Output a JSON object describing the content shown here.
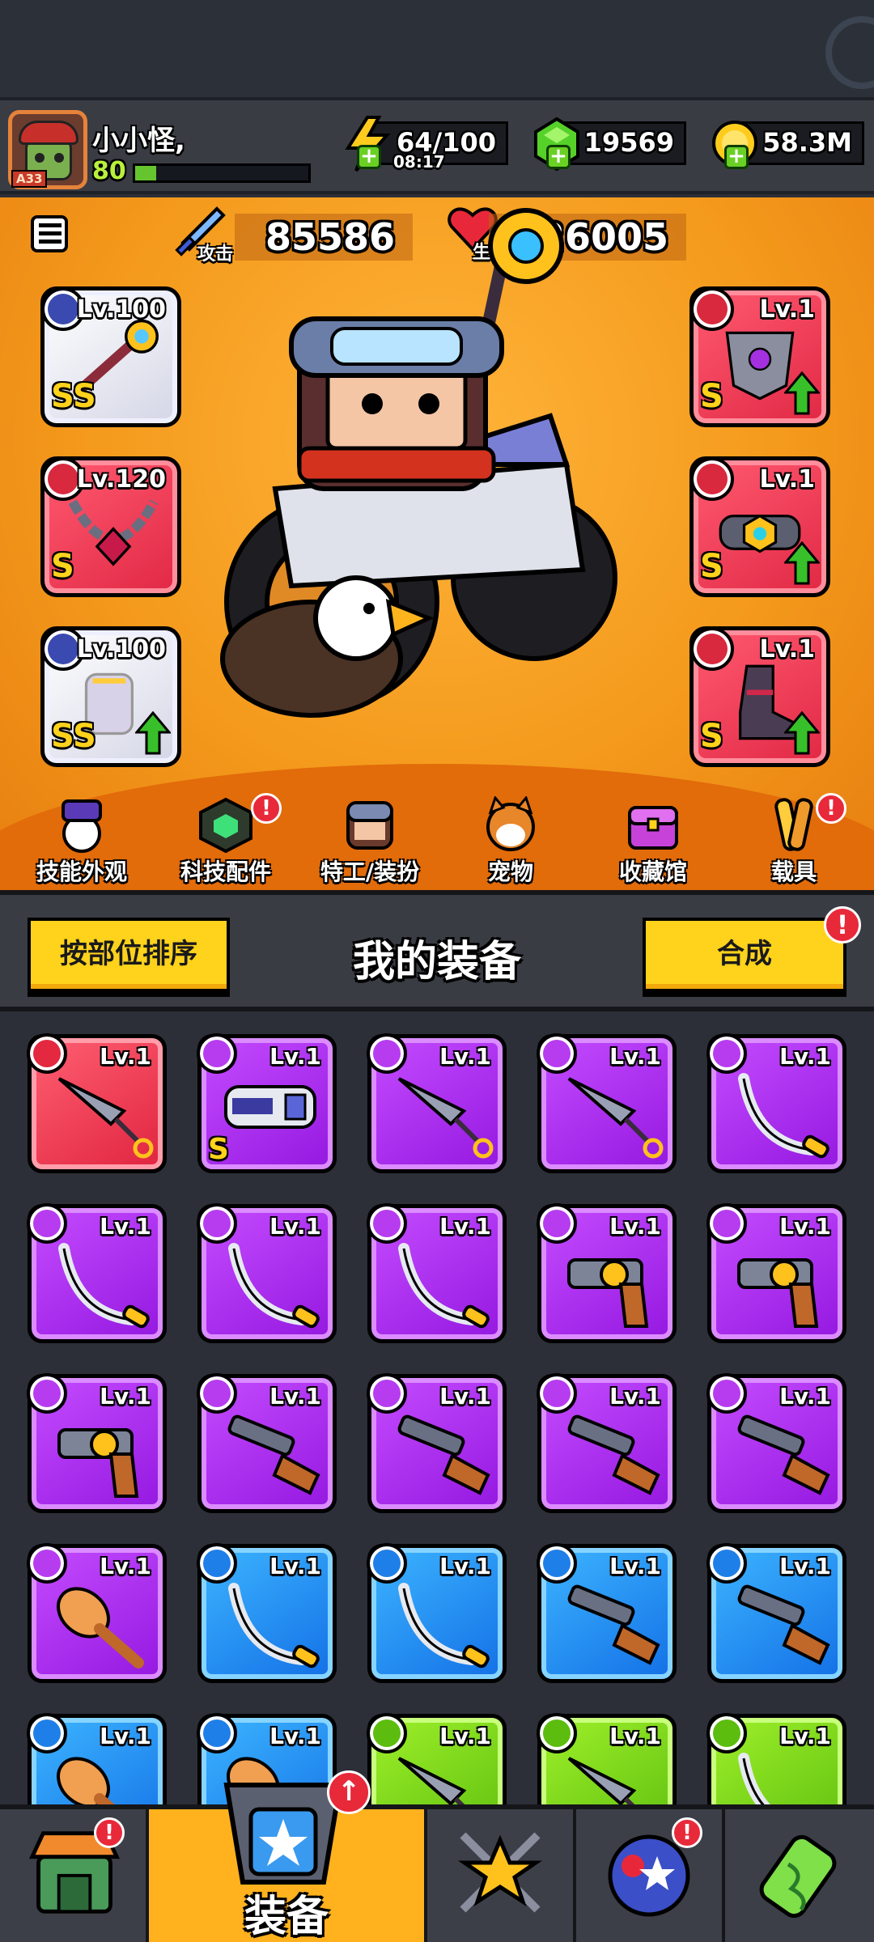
{
  "player": {
    "name": "小小怪,",
    "level": "80",
    "rank": "A33",
    "exp_fraction": 0.12
  },
  "resources": {
    "energy": "64/100",
    "energy_timer": "08:17",
    "gems": "19569",
    "coins": "58.3M"
  },
  "stats": {
    "attack_label": "攻击",
    "attack_value": "85586",
    "hp_label": "生命",
    "hp_value": "226005"
  },
  "equipped": {
    "left": [
      {
        "slot": "weapon",
        "level": "Lv.100",
        "grade": "SS",
        "rarity": "white",
        "upgrade": false
      },
      {
        "slot": "necklace",
        "level": "Lv.120",
        "grade": "S",
        "rarity": "red",
        "upgrade": false
      },
      {
        "slot": "gloves",
        "level": "Lv.100",
        "grade": "SS",
        "rarity": "white",
        "upgrade": true
      }
    ],
    "right": [
      {
        "slot": "armor",
        "level": "Lv.1",
        "grade": "S",
        "rarity": "red",
        "upgrade": true
      },
      {
        "slot": "belt",
        "level": "Lv.1",
        "grade": "S",
        "rarity": "red",
        "upgrade": true
      },
      {
        "slot": "boots",
        "level": "Lv.1",
        "grade": "S",
        "rarity": "red",
        "upgrade": true
      }
    ]
  },
  "hero_nav": [
    {
      "label": "技能外观",
      "icon": "hat-ball-icon",
      "alert": false
    },
    {
      "label": "科技配件",
      "icon": "tech-chip-icon",
      "alert": true
    },
    {
      "label": "特工/装扮",
      "icon": "agent-icon",
      "alert": false
    },
    {
      "label": "宠物",
      "icon": "dog-pet-icon",
      "alert": false
    },
    {
      "label": "收藏馆",
      "icon": "chest-icon",
      "alert": false
    },
    {
      "label": "载具",
      "icon": "skateboard-icon",
      "alert": true
    }
  ],
  "inventory": {
    "sort_label": "按部位排序",
    "title": "我的装备",
    "craft_label": "合成",
    "craft_alert": "!",
    "items": [
      {
        "level": "Lv.1",
        "rarity": "red",
        "type": "kunai",
        "grade": ""
      },
      {
        "level": "Lv.1",
        "rarity": "purple",
        "type": "blaster",
        "grade": "S"
      },
      {
        "level": "Lv.1",
        "rarity": "purple",
        "type": "kunai",
        "grade": ""
      },
      {
        "level": "Lv.1",
        "rarity": "purple",
        "type": "kunai",
        "grade": ""
      },
      {
        "level": "Lv.1",
        "rarity": "purple",
        "type": "katana",
        "grade": ""
      },
      {
        "level": "Lv.1",
        "rarity": "purple",
        "type": "katana",
        "grade": ""
      },
      {
        "level": "Lv.1",
        "rarity": "purple",
        "type": "katana",
        "grade": ""
      },
      {
        "level": "Lv.1",
        "rarity": "purple",
        "type": "katana",
        "grade": ""
      },
      {
        "level": "Lv.1",
        "rarity": "purple",
        "type": "revolver",
        "grade": ""
      },
      {
        "level": "Lv.1",
        "rarity": "purple",
        "type": "revolver",
        "grade": ""
      },
      {
        "level": "Lv.1",
        "rarity": "purple",
        "type": "revolver",
        "grade": ""
      },
      {
        "level": "Lv.1",
        "rarity": "purple",
        "type": "shotgun",
        "grade": ""
      },
      {
        "level": "Lv.1",
        "rarity": "purple",
        "type": "shotgun",
        "grade": ""
      },
      {
        "level": "Lv.1",
        "rarity": "purple",
        "type": "shotgun",
        "grade": ""
      },
      {
        "level": "Lv.1",
        "rarity": "purple",
        "type": "shotgun",
        "grade": ""
      },
      {
        "level": "Lv.1",
        "rarity": "purple",
        "type": "club",
        "grade": ""
      },
      {
        "level": "Lv.1",
        "rarity": "blue",
        "type": "katana",
        "grade": ""
      },
      {
        "level": "Lv.1",
        "rarity": "blue",
        "type": "katana",
        "grade": ""
      },
      {
        "level": "Lv.1",
        "rarity": "blue",
        "type": "shotgun",
        "grade": ""
      },
      {
        "level": "Lv.1",
        "rarity": "blue",
        "type": "shotgun",
        "grade": ""
      },
      {
        "level": "Lv.1",
        "rarity": "blue",
        "type": "club",
        "grade": ""
      },
      {
        "level": "Lv.1",
        "rarity": "blue",
        "type": "club",
        "grade": ""
      },
      {
        "level": "Lv.1",
        "rarity": "green",
        "type": "kunai",
        "grade": ""
      },
      {
        "level": "Lv.1",
        "rarity": "green",
        "type": "kunai",
        "grade": ""
      },
      {
        "level": "Lv.1",
        "rarity": "green",
        "type": "katana",
        "grade": ""
      }
    ]
  },
  "bottom_nav": [
    {
      "icon": "shop-icon",
      "alert": true
    },
    {
      "label": "装备",
      "icon": "equipment-icon",
      "active": true,
      "alert": true
    },
    {
      "icon": "battle-star-icon",
      "alert": false
    },
    {
      "icon": "star-orb-icon",
      "alert": true
    },
    {
      "icon": "dna-capsule-icon",
      "alert": false
    }
  ],
  "colors": {
    "hero_bg": "#f49a1c",
    "accent_yellow": "#ffd21c",
    "alert_red": "#e8293a",
    "panel_dark": "#3a3c44"
  }
}
